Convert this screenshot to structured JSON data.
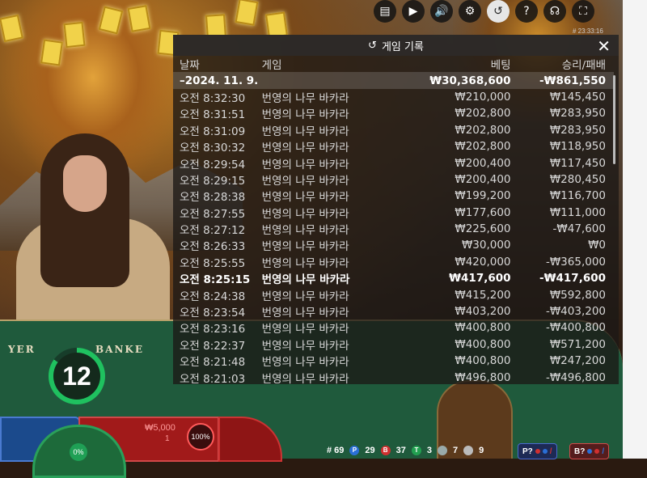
{
  "toolbar": {
    "buttons": [
      "chat-icon",
      "video-icon",
      "sound-icon",
      "settings-icon",
      "history-icon",
      "help-icon",
      "headset-icon",
      "fullscreen-icon"
    ],
    "glyphs": [
      "▤",
      "▶",
      "🔊",
      "⚙",
      "↺",
      "?",
      "☊",
      "⛶"
    ],
    "clock": "# 23:33:16"
  },
  "history": {
    "title": "게임 기록",
    "columns": {
      "date": "날짜",
      "game": "게임",
      "bet": "베팅",
      "result": "승리/패배"
    },
    "summary": {
      "date": "–2024. 11. 9.",
      "game": "",
      "bet": "₩30,368,600",
      "result": "-₩861,550"
    },
    "rows": [
      {
        "date": "오전 8:32:30",
        "game": "번영의 나무 바카라",
        "bet": "₩210,000",
        "result": "₩145,450"
      },
      {
        "date": "오전 8:31:51",
        "game": "번영의 나무 바카라",
        "bet": "₩202,800",
        "result": "₩283,950"
      },
      {
        "date": "오전 8:31:09",
        "game": "번영의 나무 바카라",
        "bet": "₩202,800",
        "result": "₩283,950"
      },
      {
        "date": "오전 8:30:32",
        "game": "번영의 나무 바카라",
        "bet": "₩202,800",
        "result": "₩118,950"
      },
      {
        "date": "오전 8:29:54",
        "game": "번영의 나무 바카라",
        "bet": "₩200,400",
        "result": "₩117,450"
      },
      {
        "date": "오전 8:29:15",
        "game": "번영의 나무 바카라",
        "bet": "₩200,400",
        "result": "₩280,450"
      },
      {
        "date": "오전 8:28:38",
        "game": "번영의 나무 바카라",
        "bet": "₩199,200",
        "result": "₩116,700"
      },
      {
        "date": "오전 8:27:55",
        "game": "번영의 나무 바카라",
        "bet": "₩177,600",
        "result": "₩111,000"
      },
      {
        "date": "오전 8:27:12",
        "game": "번영의 나무 바카라",
        "bet": "₩225,600",
        "result": "-₩47,600"
      },
      {
        "date": "오전 8:26:33",
        "game": "번영의 나무 바카라",
        "bet": "₩30,000",
        "result": "₩0"
      },
      {
        "date": "오전 8:25:55",
        "game": "번영의 나무 바카라",
        "bet": "₩420,000",
        "result": "-₩365,000"
      },
      {
        "date": "오전 8:25:15",
        "game": "번영의 나무 바카라",
        "bet": "₩417,600",
        "result": "-₩417,600",
        "highlight": true
      },
      {
        "date": "오전 8:24:38",
        "game": "번영의 나무 바카라",
        "bet": "₩415,200",
        "result": "₩592,800"
      },
      {
        "date": "오전 8:23:54",
        "game": "번영의 나무 바카라",
        "bet": "₩403,200",
        "result": "-₩403,200"
      },
      {
        "date": "오전 8:23:16",
        "game": "번영의 나무 바카라",
        "bet": "₩400,800",
        "result": "-₩400,800"
      },
      {
        "date": "오전 8:22:37",
        "game": "번영의 나무 바카라",
        "bet": "₩400,800",
        "result": "₩571,200"
      },
      {
        "date": "오전 8:21:48",
        "game": "번영의 나무 바카라",
        "bet": "₩400,800",
        "result": "₩247,200"
      },
      {
        "date": "오전 8:21:03",
        "game": "번영의 나무 바카라",
        "bet": "₩496,800",
        "result": "-₩496,800"
      }
    ]
  },
  "table": {
    "player_label": "YER",
    "banker_label": "BANKE",
    "timer": "12",
    "banker_bet": "₩5,000",
    "banker_sub": "1",
    "banker_pct": "100%",
    "player_pct": "0%"
  },
  "stats": {
    "round": "# 69",
    "player_glyph": "P",
    "player_count": "29",
    "banker_glyph": "B",
    "banker_count": "37",
    "tie_glyph": "T",
    "tie_count": "3",
    "player_pair_count": "7",
    "banker_pair_count": "9",
    "player_predict": "P?",
    "banker_predict": "B?"
  },
  "colors": {
    "player": "#2a6fd6",
    "banker": "#d03030",
    "tie": "#22a050",
    "timer": "#1fc15f"
  }
}
